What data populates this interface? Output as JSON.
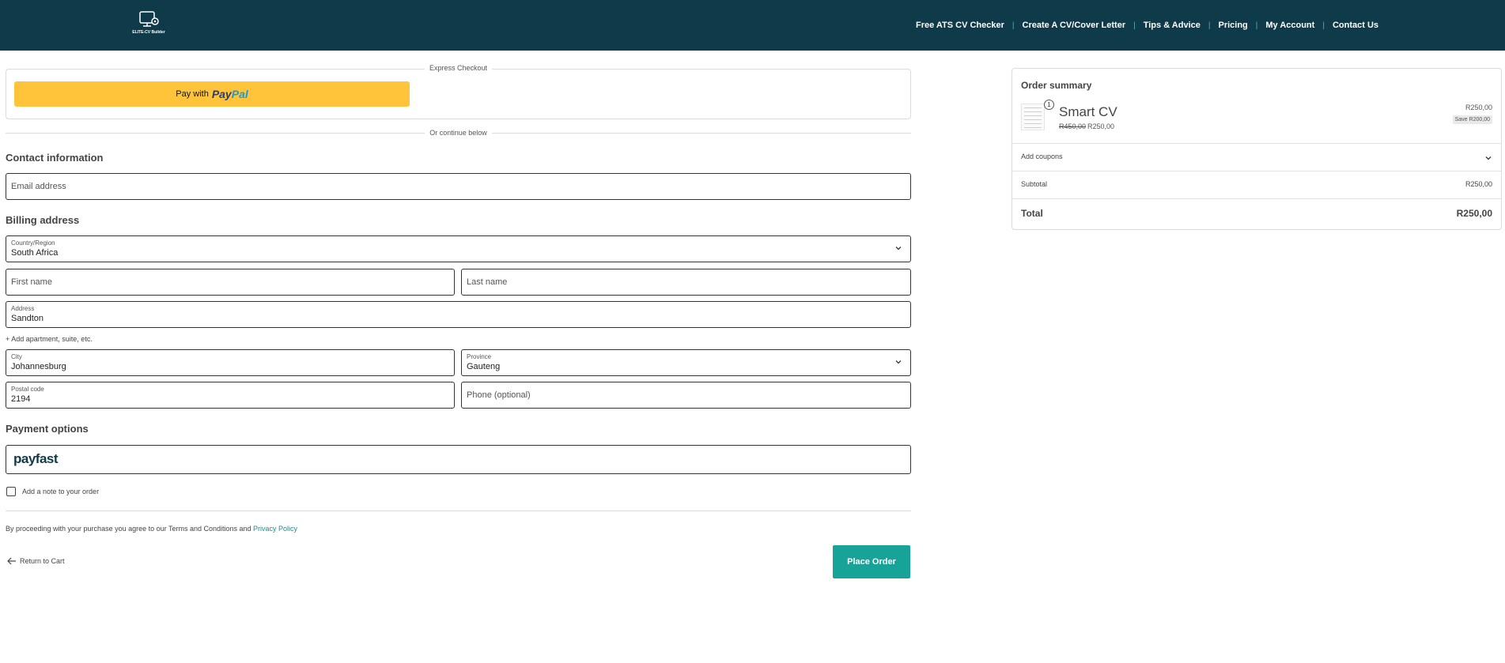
{
  "header": {
    "logo_text": "ELITE-CV Builder",
    "nav": [
      {
        "label": "Free ATS CV Checker"
      },
      {
        "label": "Create A CV/Cover Letter"
      },
      {
        "label": "Tips & Advice"
      },
      {
        "label": "Pricing"
      },
      {
        "label": "My Account"
      },
      {
        "label": "Contact Us"
      }
    ],
    "bg_color": "#0e3a4a"
  },
  "express": {
    "label": "Express Checkout",
    "paypal_prefix": "Pay with",
    "paypal_logo_a": "Pay",
    "paypal_logo_b": "Pal"
  },
  "or_continue": "Or continue below",
  "contact": {
    "title": "Contact information",
    "email_placeholder": "Email address"
  },
  "billing": {
    "title": "Billing address",
    "country_label": "Country/Region",
    "country_value": "South Africa",
    "first_name_placeholder": "First name",
    "last_name_placeholder": "Last name",
    "address_label": "Address",
    "address_value": "Sandton",
    "add_apartment": "+ Add apartment, suite, etc.",
    "city_label": "City",
    "city_value": "Johannesburg",
    "province_label": "Province",
    "province_value": "Gauteng",
    "postal_label": "Postal code",
    "postal_value": "2194",
    "phone_placeholder": "Phone (optional)"
  },
  "payment": {
    "title": "Payment options",
    "method": "payfast"
  },
  "note_label": "Add a note to your order",
  "terms": {
    "text": "By proceeding with your purchase you agree to our Terms and Conditions and",
    "link": "Privacy Policy"
  },
  "return_label": "Return to Cart",
  "place_order_label": "Place Order",
  "accent_color": "#17a398",
  "summary": {
    "title": "Order summary",
    "item": {
      "quantity": "1",
      "name": "Smart CV",
      "old_price": "R450,00",
      "new_price": "R250,00",
      "line_price": "R250,00",
      "save": "Save R200,00"
    },
    "coupons_label": "Add coupons",
    "subtotal_label": "Subtotal",
    "subtotal_value": "R250,00",
    "total_label": "Total",
    "total_value": "R250,00"
  }
}
